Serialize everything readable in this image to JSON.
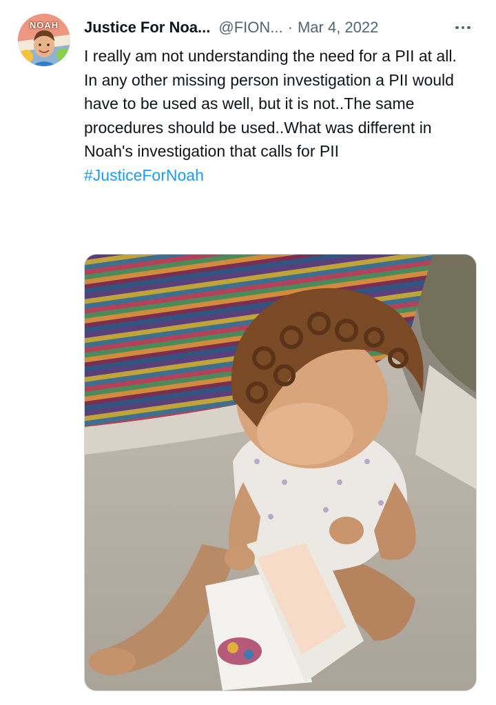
{
  "tweet": {
    "author_name": "Justice For Noa...",
    "author_handle": "@FION...",
    "separator": "·",
    "date": "Mar 4, 2022",
    "avatar": {
      "badge_text": "NOAH",
      "icon": "profile-avatar"
    },
    "more_icon": "more-horizontal-icon",
    "text_lines": [
      "I really am not understanding the need for a PII at all.",
      "In any other missing person investigation a PII would have to be used as well, but it is not..The same procedures should be used..What was different in Noah's investigation  that calls for PII"
    ],
    "hashtag": "#JusticeForNoah",
    "media": {
      "icon": "photo-media"
    }
  },
  "colors": {
    "text": "#0f1419",
    "secondary": "#536471",
    "link": "#1d9bf0",
    "border": "#cfd9de"
  }
}
